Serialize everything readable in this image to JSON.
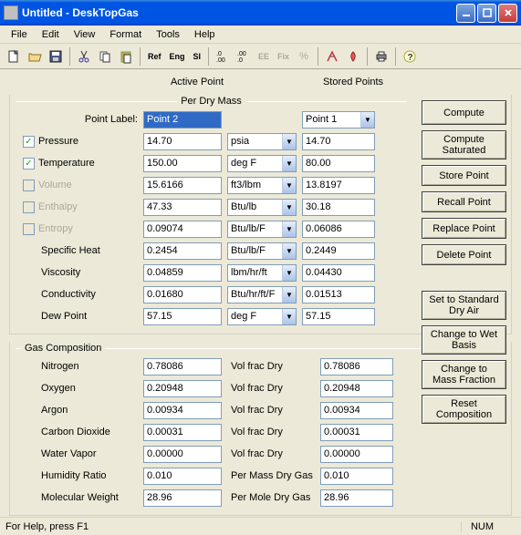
{
  "window": {
    "title": "Untitled - DeskTopGas"
  },
  "menu": {
    "file": "File",
    "edit": "Edit",
    "view": "View",
    "format": "Format",
    "tools": "Tools",
    "help": "Help"
  },
  "toolbar": {
    "ref": "Ref",
    "eng": "Eng",
    "si": "SI",
    "ee": "EE",
    "fix": "Fix"
  },
  "headers": {
    "active": "Active Point",
    "stored": "Stored Points",
    "group1": "Per Dry Mass",
    "group2": "Gas Composition"
  },
  "labels": {
    "pointLabel": "Point Label:",
    "pressure": "Pressure",
    "temperature": "Temperature",
    "volume": "Volume",
    "enthalpy": "Enthalpy",
    "entropy": "Entropy",
    "specificHeat": "Specific Heat",
    "viscosity": "Viscosity",
    "conductivity": "Conductivity",
    "dewPoint": "Dew Point",
    "nitrogen": "Nitrogen",
    "oxygen": "Oxygen",
    "argon": "Argon",
    "carbonDioxide": "Carbon Dioxide",
    "waterVapor": "Water Vapor",
    "humidityRatio": "Humidity Ratio",
    "molecularWeight": "Molecular Weight"
  },
  "units": {
    "psia": "psia",
    "degF": "deg F",
    "ft3lbm": "ft3/lbm",
    "btulb": "Btu/lb",
    "btulbF": "Btu/lb/F",
    "lbmhrft": "lbm/hr/ft",
    "btuhrftF": "Btu/hr/ft/F",
    "volFracDry": "Vol frac Dry",
    "perMassDryGas": "Per Mass Dry Gas",
    "perMoleDryGas": "Per Mole Dry Gas"
  },
  "active": {
    "pointLabel": "Point 2",
    "pressure": "14.70",
    "temperature": "150.00",
    "volume": "15.6166",
    "enthalpy": "47.33",
    "entropy": "0.09074",
    "specificHeat": "0.2454",
    "viscosity": "0.04859",
    "conductivity": "0.01680",
    "dewPoint": "57.15"
  },
  "stored": {
    "pointLabel": "Point 1",
    "pressure": "14.70",
    "temperature": "80.00",
    "volume": "13.8197",
    "enthalpy": "30.18",
    "entropy": "0.06086",
    "specificHeat": "0.2449",
    "viscosity": "0.04430",
    "conductivity": "0.01513",
    "dewPoint": "57.15"
  },
  "comp": {
    "nitrogen": {
      "a": "0.78086",
      "s": "0.78086"
    },
    "oxygen": {
      "a": "0.20948",
      "s": "0.20948"
    },
    "argon": {
      "a": "0.00934",
      "s": "0.00934"
    },
    "carbonDioxide": {
      "a": "0.00031",
      "s": "0.00031"
    },
    "waterVapor": {
      "a": "0.00000",
      "s": "0.00000"
    },
    "humidityRatio": {
      "a": "0.010",
      "s": "0.010"
    },
    "molecularWeight": {
      "a": "28.96",
      "s": "28.96"
    }
  },
  "buttons": {
    "compute": "Compute",
    "computeSat": "Compute Saturated",
    "storePoint": "Store Point",
    "recallPoint": "Recall Point",
    "replacePoint": "Replace Point",
    "deletePoint": "Delete Point",
    "setStdDryAir": "Set to Standard Dry Air",
    "changeWetBasis": "Change to Wet Basis",
    "changeMassFrac": "Change to Mass Fraction",
    "resetComp": "Reset Composition"
  },
  "status": {
    "help": "For Help, press F1",
    "num": "NUM"
  }
}
